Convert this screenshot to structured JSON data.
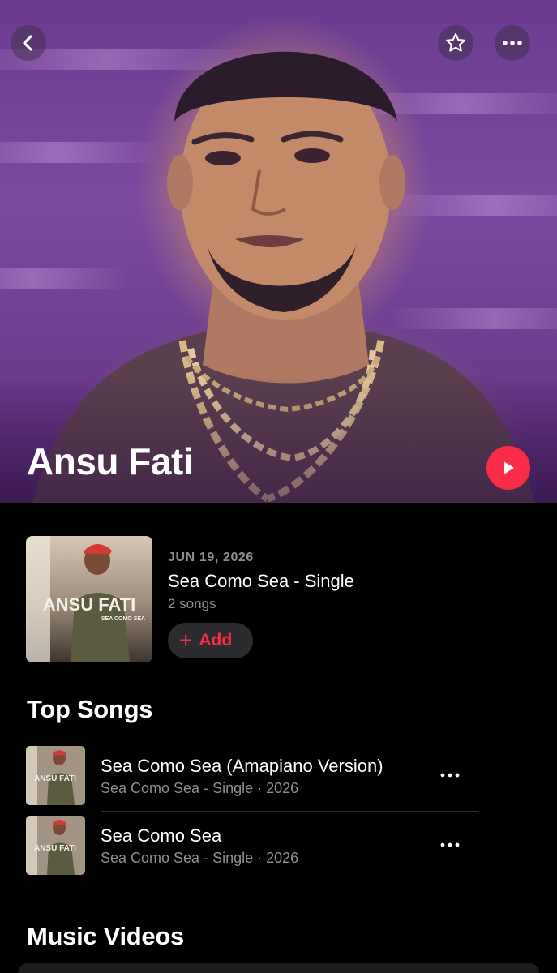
{
  "header": {
    "artist_name": "Ansu Fati",
    "icons": {
      "back": "chevron-left-icon",
      "favorite": "star-icon",
      "more": "ellipsis-icon",
      "play": "play-icon"
    }
  },
  "latest_release": {
    "date": "JUN 19, 2026",
    "title": "Sea Como Sea - Single",
    "count": "2 songs",
    "add_label": "Add",
    "art_text": {
      "artist": "ANSU FATI",
      "title": "SEA COMO SEA"
    }
  },
  "top_songs": {
    "title": "Top Songs",
    "items": [
      {
        "title": "Sea Como Sea (Amapiano Version)",
        "subtitle": "Sea Como Sea - Single · 2026"
      },
      {
        "title": "Sea Como Sea",
        "subtitle": "Sea Como Sea - Single · 2026"
      }
    ]
  },
  "music_videos": {
    "title": "Music Videos"
  },
  "colors": {
    "accent": "#fa2d48",
    "secondary_text": "#8e8e93",
    "background": "#000000"
  }
}
